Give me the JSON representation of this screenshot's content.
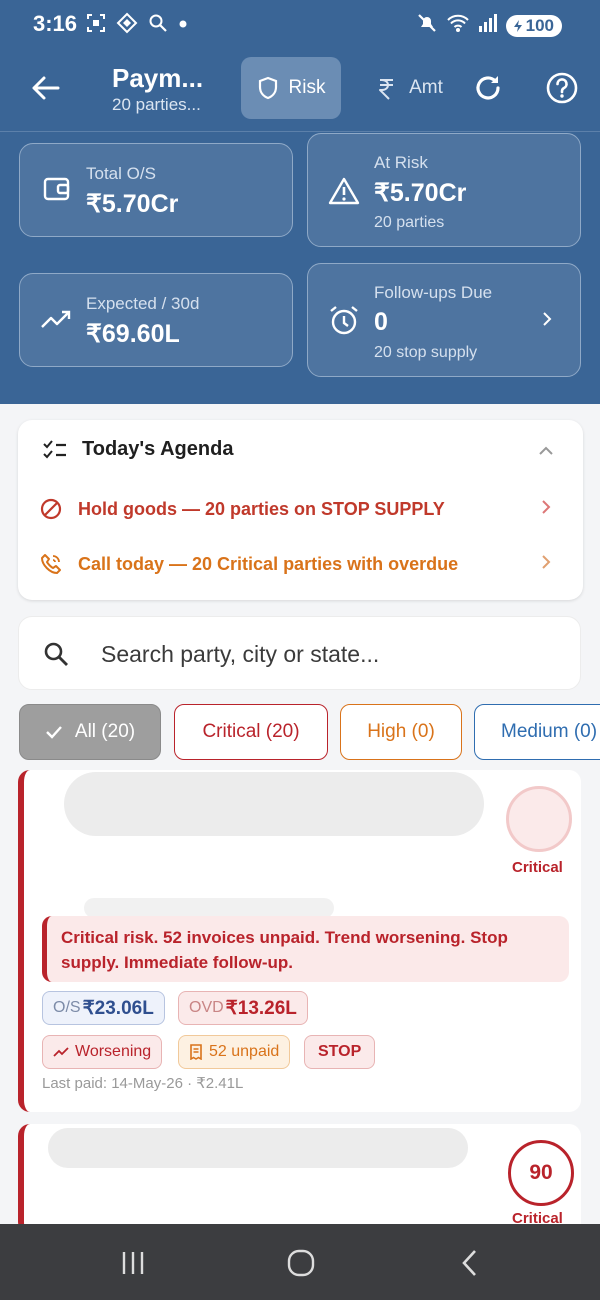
{
  "status_bar": {
    "time": "3:16",
    "battery": "100",
    "left_icons": [
      "screenshot-icon",
      "app-icon",
      "search-icon",
      "dot-icon"
    ],
    "right_icons": [
      "mute-icon",
      "wifi-icon",
      "signal-icon",
      "battery-icon"
    ]
  },
  "appbar": {
    "title": "Paym...",
    "subtitle": "20 parties...",
    "tab_risk": "Risk",
    "tab_amt": "Amt"
  },
  "summary": {
    "total_os_label": "Total O/S",
    "total_os_value": "₹5.70Cr",
    "at_risk_label": "At Risk",
    "at_risk_value": "₹5.70Cr",
    "at_risk_sub": "20 parties",
    "expected_label": "Expected / 30d",
    "expected_value": "₹69.60L",
    "followups_label": "Follow-ups Due",
    "followups_value": "0",
    "followups_sub": "20 stop supply"
  },
  "agenda": {
    "title": "Today's Agenda",
    "items": [
      {
        "text": "Hold goods — 20 parties on STOP SUPPLY",
        "color": "#c0392b"
      },
      {
        "text": "Call today — 20 Critical parties with overdue",
        "color": "#d9731a"
      }
    ]
  },
  "search": {
    "placeholder": "Search party, city or state..."
  },
  "filters": [
    {
      "label": "All (20)",
      "selected": true
    },
    {
      "label": "Critical (20)",
      "color": "#b9232b"
    },
    {
      "label": "High (0)",
      "color": "#d9731a"
    },
    {
      "label": "Medium (0)",
      "color": "#2f6db0"
    }
  ],
  "parties": [
    {
      "risk_label": "Critical",
      "alert": "Critical risk. 52 invoices unpaid. Trend worsening. Stop supply. Immediate follow-up.",
      "os_prefix": "O/S",
      "os_value": "₹23.06L",
      "ovd_prefix": "OVD",
      "ovd_value": "₹13.26L",
      "trend": "Worsening",
      "unpaid": "52 unpaid",
      "stop": "STOP",
      "last_paid": "Last paid: 14-May-26 · ₹2.41L"
    },
    {
      "score": "90",
      "risk_label": "Critical"
    }
  ],
  "colors": {
    "header_bg": "#3a6596",
    "critical": "#b9232b",
    "high": "#d9731a",
    "medium": "#2f6db0"
  }
}
